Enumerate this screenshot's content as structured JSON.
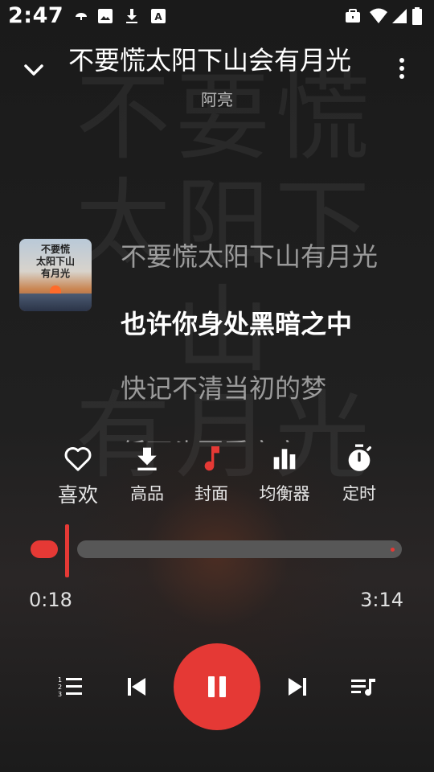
{
  "status_bar": {
    "time": "2:47"
  },
  "header": {
    "title": "不要慌太阳下山会有月光",
    "artist": "阿亮"
  },
  "background_watermark": [
    "不要慌",
    "太阳下山",
    "有月光"
  ],
  "cover": {
    "lines": [
      "不要慌",
      "太阳下山",
      "有月光"
    ]
  },
  "lyrics": {
    "lines": [
      {
        "text": "不要慌太阳下山有月光",
        "active": false
      },
      {
        "text": "也许你身处黑暗之中",
        "active": true
      },
      {
        "text": "快记不清当初的梦",
        "active": false
      },
      {
        "text": "低下头要看窗窗",
        "active": false
      }
    ]
  },
  "actions": [
    {
      "label": "喜欢",
      "icon": "heart-icon"
    },
    {
      "label": "高品",
      "icon": "download-icon"
    },
    {
      "label": "封面",
      "icon": "music-note-icon"
    },
    {
      "label": "均衡器",
      "icon": "equalizer-icon"
    },
    {
      "label": "定时",
      "icon": "timer-icon"
    }
  ],
  "progress": {
    "current": "0:18",
    "total": "3:14",
    "fraction": 0.093
  },
  "colors": {
    "accent": "#e53935",
    "background": "#1c1c1c",
    "track": "#575757"
  },
  "controls": {
    "icons": [
      "numbered-list-icon",
      "skip-previous-icon",
      "pause-icon",
      "skip-next-icon",
      "playlist-icon"
    ]
  }
}
